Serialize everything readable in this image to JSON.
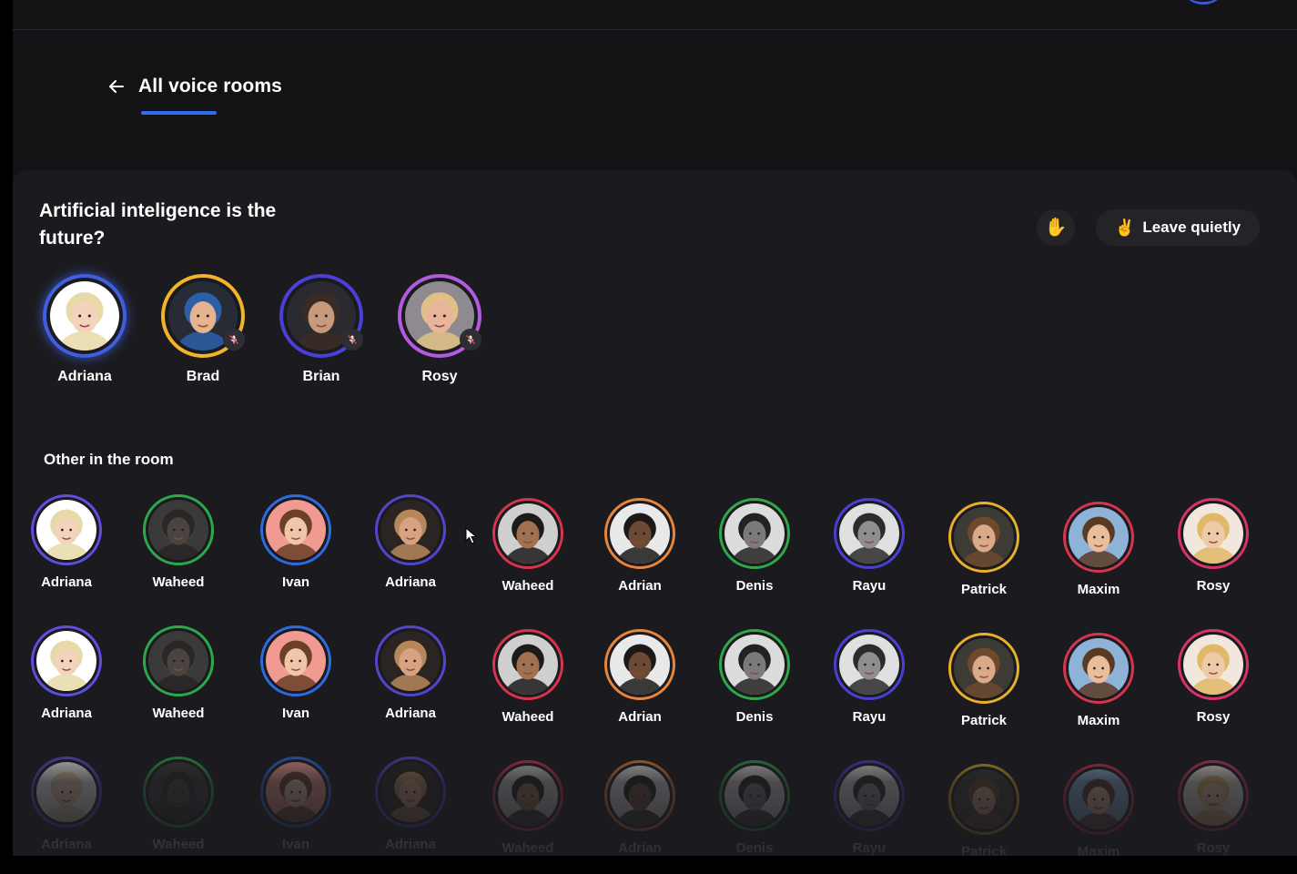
{
  "nav": {
    "back_label": "All voice rooms"
  },
  "room": {
    "title": "Artificial inteligence is the future?",
    "hand_icon": "✋",
    "leave_icon": "✌️",
    "leave_label": "Leave quietly"
  },
  "speakers": [
    {
      "name": "Adriana",
      "ring": "#3f5ee0",
      "skin": "#f3d3bd",
      "hair": "#e8d9a8",
      "bg": "#ffffff",
      "muted": false
    },
    {
      "name": "Brad",
      "ring": "#f2b42b",
      "skin": "#e5b38e",
      "hair": "#2d5fa8",
      "bg": "#272b36",
      "muted": true
    },
    {
      "name": "Brian",
      "ring": "#4a3fd6",
      "skin": "#c79a7c",
      "hair": "#3a2c24",
      "bg": "#2a2a30",
      "muted": true
    },
    {
      "name": "Rosy",
      "ring": "#b25be0",
      "skin": "#e7b69a",
      "hair": "#e1bf87",
      "bg": "#8e8a90",
      "muted": true
    }
  ],
  "section_label": "Other in the room",
  "listeners": [
    {
      "name": "Adriana",
      "ring": "#5d4fe0",
      "skin": "#f3d3bd",
      "hair": "#e8d9a8",
      "bg": "#ffffff"
    },
    {
      "name": "Waheed",
      "ring": "#2fa84a",
      "skin": "#4a4440",
      "hair": "#2a2625",
      "bg": "#3a3a3a"
    },
    {
      "name": "Ivan",
      "ring": "#2e6ae0",
      "skin": "#f0c6a8",
      "hair": "#6a4028",
      "bg": "#f09a92"
    },
    {
      "name": "Adriana",
      "ring": "#5346cc",
      "skin": "#d8a182",
      "hair": "#b5875a",
      "bg": "#2a2422"
    },
    {
      "name": "Waheed",
      "ring": "#d8334f",
      "skin": "#a0704f",
      "hair": "#1d1a1a",
      "bg": "#cfcfcf"
    },
    {
      "name": "Adrian",
      "ring": "#e8853a",
      "skin": "#6d4a35",
      "hair": "#1a1a1a",
      "bg": "#e9e9e9"
    },
    {
      "name": "Denis",
      "ring": "#2fa84a",
      "skin": "#7a7a7a",
      "hair": "#222222",
      "bg": "#dcdcdc"
    },
    {
      "name": "Rayu",
      "ring": "#4a3fd6",
      "skin": "#8e8e8e",
      "hair": "#2b2b2b",
      "bg": "#e0e0e0"
    },
    {
      "name": "Patrick",
      "ring": "#e9b12a",
      "skin": "#d9a98a",
      "hair": "#6d4a2e",
      "bg": "#3d3b36"
    },
    {
      "name": "Maxim",
      "ring": "#d8334f",
      "skin": "#e8bd9c",
      "hair": "#5b3a23",
      "bg": "#8fb3d8"
    },
    {
      "name": "Rosy",
      "ring": "#d8336b",
      "skin": "#f0c9a6",
      "hair": "#e0b868",
      "bg": "#f2e7dd"
    }
  ]
}
